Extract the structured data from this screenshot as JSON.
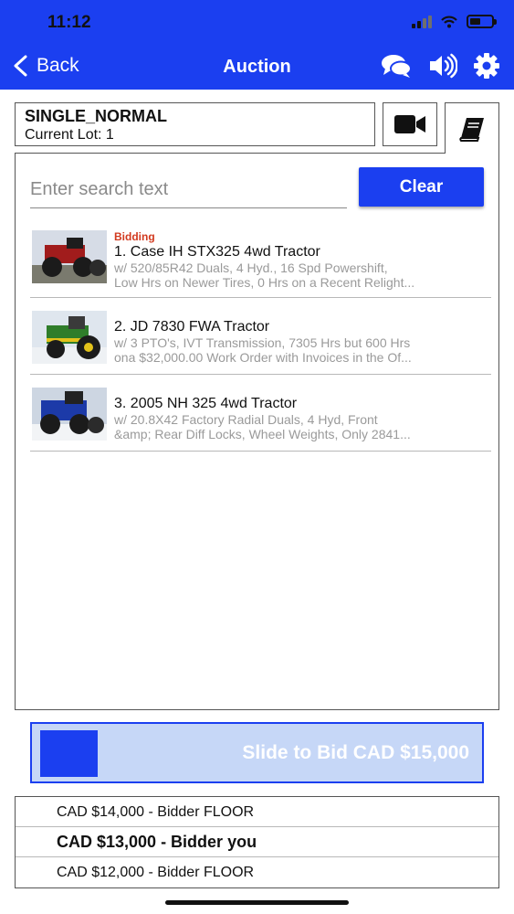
{
  "status_bar": {
    "time": "11:12"
  },
  "nav": {
    "back_label": "Back",
    "title": "Auction",
    "icons": [
      "chat-icon",
      "speaker-icon",
      "gear-icon"
    ]
  },
  "lot_header": {
    "name": "SINGLE_NORMAL",
    "current_lot": "Current Lot: 1"
  },
  "search": {
    "placeholder": "Enter search text",
    "clear_label": "Clear"
  },
  "lots": [
    {
      "status": "Bidding",
      "title": "1. Case IH STX325 4wd Tractor",
      "desc_line1": "w/ 520/85R42 Duals, 4 Hyd., 16 Spd Powershift,",
      "desc_line2": "Low Hrs on Newer Tires, 0 Hrs on a Recent Relight..."
    },
    {
      "status": "",
      "title": "2. JD 7830 FWA Tractor",
      "desc_line1": "w/ 3 PTO's, IVT Transmission, 7305 Hrs but 600 Hrs",
      "desc_line2": "ona $32,000.00 Work Order with Invoices in the Of..."
    },
    {
      "status": "",
      "title": "3. 2005 NH 325 4wd Tractor",
      "desc_line1": "w/ 20.8X42 Factory Radial Duals, 4 Hyd, Front",
      "desc_line2": "&amp; Rear Diff Locks, Wheel Weights, Only 2841..."
    }
  ],
  "slide_bid": {
    "label": "Slide to Bid CAD $15,000"
  },
  "bid_history": [
    {
      "text": "CAD $14,000 - Bidder FLOOR",
      "bold": false
    },
    {
      "text": "CAD $13,000 - Bidder you",
      "bold": true
    },
    {
      "text": "CAD $12,000 - Bidder FLOOR",
      "bold": false
    }
  ],
  "colors": {
    "brand": "#1b3ff0",
    "bidding": "#d23a1f",
    "slide_track": "#c6d7f7"
  }
}
